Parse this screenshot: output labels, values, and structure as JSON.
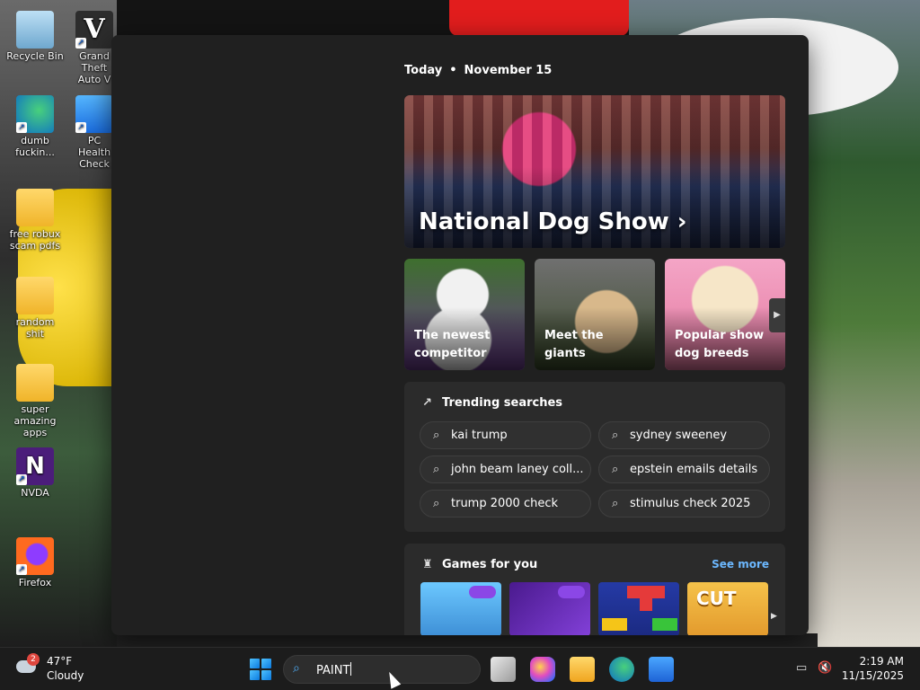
{
  "desktop": {
    "icons": [
      {
        "label": "Recycle Bin",
        "icon": "recycle-bin-icon"
      },
      {
        "label": "Grand Theft Auto V",
        "icon": "gta-icon"
      },
      {
        "label": "dumb fuckin...",
        "icon": "edge-icon"
      },
      {
        "label": "PC Health Check",
        "icon": "pc-health-icon"
      },
      {
        "label": "free robux scam pdfs",
        "icon": "folder-icon"
      },
      {
        "label": "random shit",
        "icon": "folder-icon"
      },
      {
        "label": "super amazing apps",
        "icon": "folder-icon"
      },
      {
        "label": "NVDA",
        "icon": "nvda-icon"
      },
      {
        "label": "Firefox",
        "icon": "firefox-icon"
      }
    ]
  },
  "widgets": {
    "today_label": "Today",
    "date": "November 15",
    "hero": {
      "title": "National Dog Show ›"
    },
    "cards": [
      {
        "label": "The newest competitor"
      },
      {
        "label": "Meet the giants"
      },
      {
        "label": "Popular show dog breeds"
      }
    ],
    "trending": {
      "title": "Trending searches",
      "items": [
        "kai trump",
        "sydney sweeney",
        "john beam laney coll...",
        "epstein emails details",
        "trump 2000 check",
        "stimulus check 2025"
      ]
    },
    "games": {
      "title": "Games for you",
      "see_more": "See more",
      "tiles": [
        "crazy-games-tile",
        "crazy-games-tile-2",
        "blocks-tile",
        "cut-the-rope-tile"
      ],
      "tile4_word": "CUT"
    }
  },
  "taskbar": {
    "weather": {
      "badge": "2",
      "temp": "47°F",
      "condition": "Cloudy"
    },
    "search": {
      "value": "PAINT"
    },
    "clock": {
      "time": "2:19 AM",
      "date": "11/15/2025"
    }
  }
}
